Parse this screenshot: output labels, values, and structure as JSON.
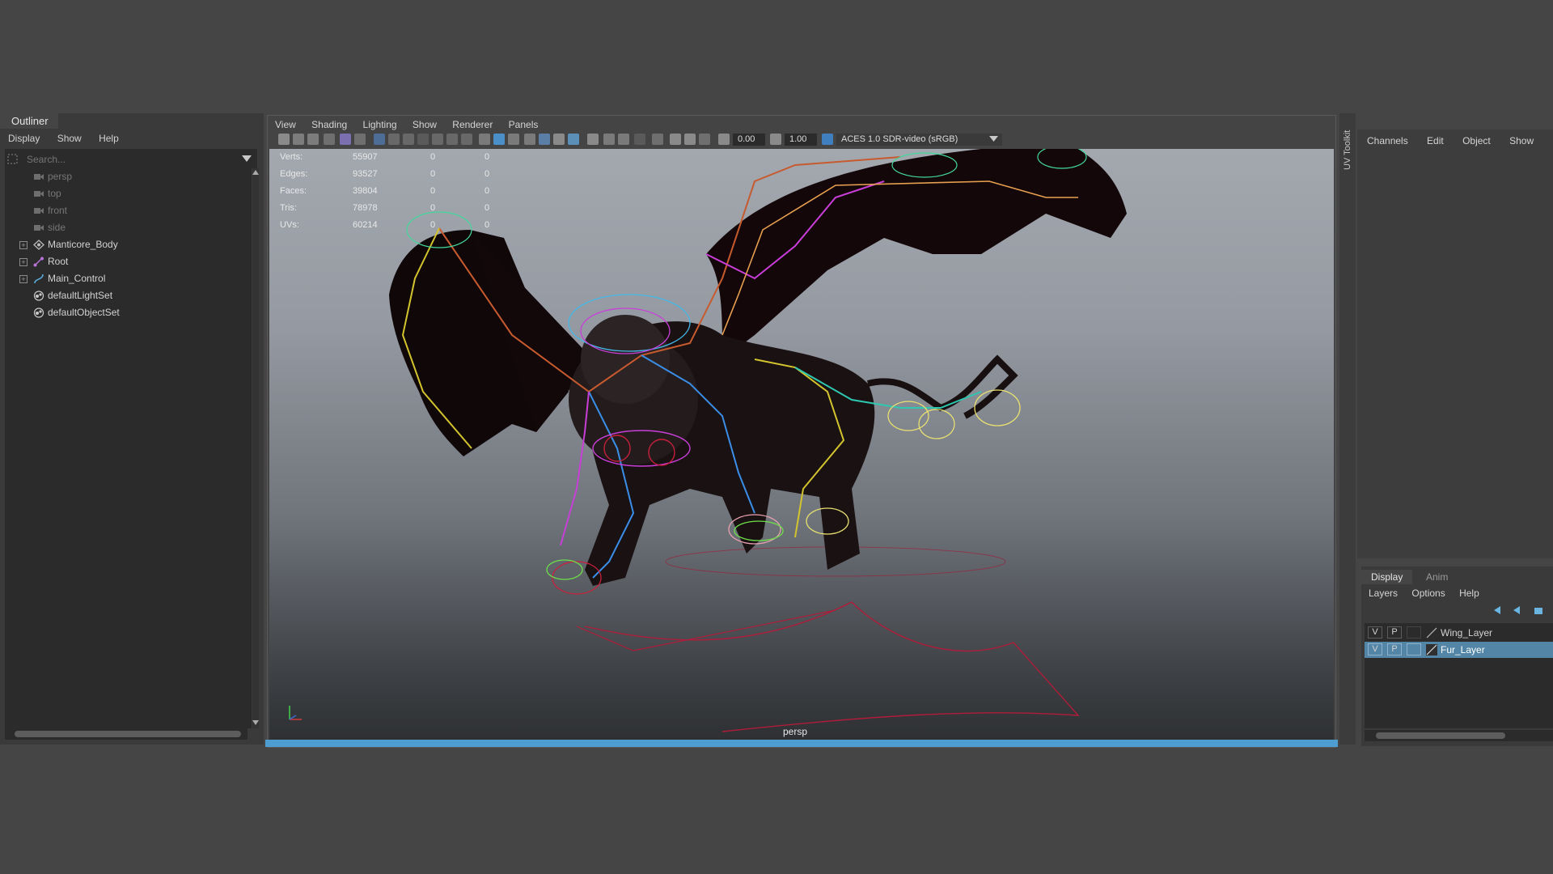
{
  "outliner": {
    "tab": "Outliner",
    "menu": [
      "Display",
      "Show",
      "Help"
    ],
    "search_placeholder": "Search...",
    "items": [
      {
        "label": "persp",
        "icon": "camera-icon",
        "dim": true
      },
      {
        "label": "top",
        "icon": "camera-icon",
        "dim": true
      },
      {
        "label": "front",
        "icon": "camera-icon",
        "dim": true
      },
      {
        "label": "side",
        "icon": "camera-icon",
        "dim": true
      },
      {
        "label": "Manticore_Body",
        "icon": "group-icon",
        "expandable": true
      },
      {
        "label": "Root",
        "icon": "joint-icon",
        "expandable": true
      },
      {
        "label": "Main_Control",
        "icon": "curve-icon",
        "expandable": true
      },
      {
        "label": "defaultLightSet",
        "icon": "set-icon"
      },
      {
        "label": "defaultObjectSet",
        "icon": "set-icon"
      }
    ]
  },
  "viewport": {
    "menu": [
      "View",
      "Shading",
      "Lighting",
      "Show",
      "Renderer",
      "Panels"
    ],
    "exposure": "0.00",
    "gamma": "1.00",
    "color_space": "ACES 1.0 SDR-video (sRGB)",
    "camera_label": "persp",
    "hud": [
      {
        "label": "Verts:",
        "value": "55907",
        "a": "0",
        "b": "0"
      },
      {
        "label": "Edges:",
        "value": "93527",
        "a": "0",
        "b": "0"
      },
      {
        "label": "Faces:",
        "value": "39804",
        "a": "0",
        "b": "0"
      },
      {
        "label": "Tris:",
        "value": "78978",
        "a": "0",
        "b": "0"
      },
      {
        "label": "UVs:",
        "value": "60214",
        "a": "0",
        "b": "0"
      }
    ],
    "colors": {
      "timeline": "#4e9dd1",
      "gradient_top": "#a3a8af",
      "gradient_bottom": "#2e3033"
    }
  },
  "side_strip": {
    "label": "UV Toolkit"
  },
  "channel_box": {
    "menu": [
      "Channels",
      "Edit",
      "Object",
      "Show"
    ]
  },
  "layer_editor": {
    "tabs": [
      "Display",
      "Anim"
    ],
    "menu": [
      "Layers",
      "Options",
      "Help"
    ],
    "layers": [
      {
        "v": "V",
        "p": "P",
        "name": "Wing_Layer",
        "selected": false
      },
      {
        "v": "V",
        "p": "P",
        "name": "Fur_Layer",
        "selected": true
      }
    ],
    "selected_color": "#5285a6"
  }
}
